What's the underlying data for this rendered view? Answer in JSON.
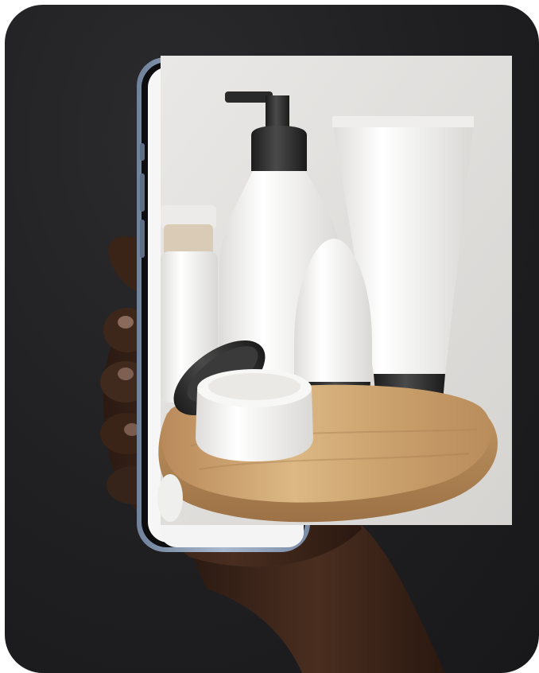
{
  "scene": {
    "description_visible_text": "",
    "background_color": "#1f1f21",
    "phone_frame_color": "#8fa3bf",
    "product_colors": {
      "white": "#f4f3f1",
      "cap": "#2b2b2b",
      "wood": "#c9a06a"
    }
  }
}
